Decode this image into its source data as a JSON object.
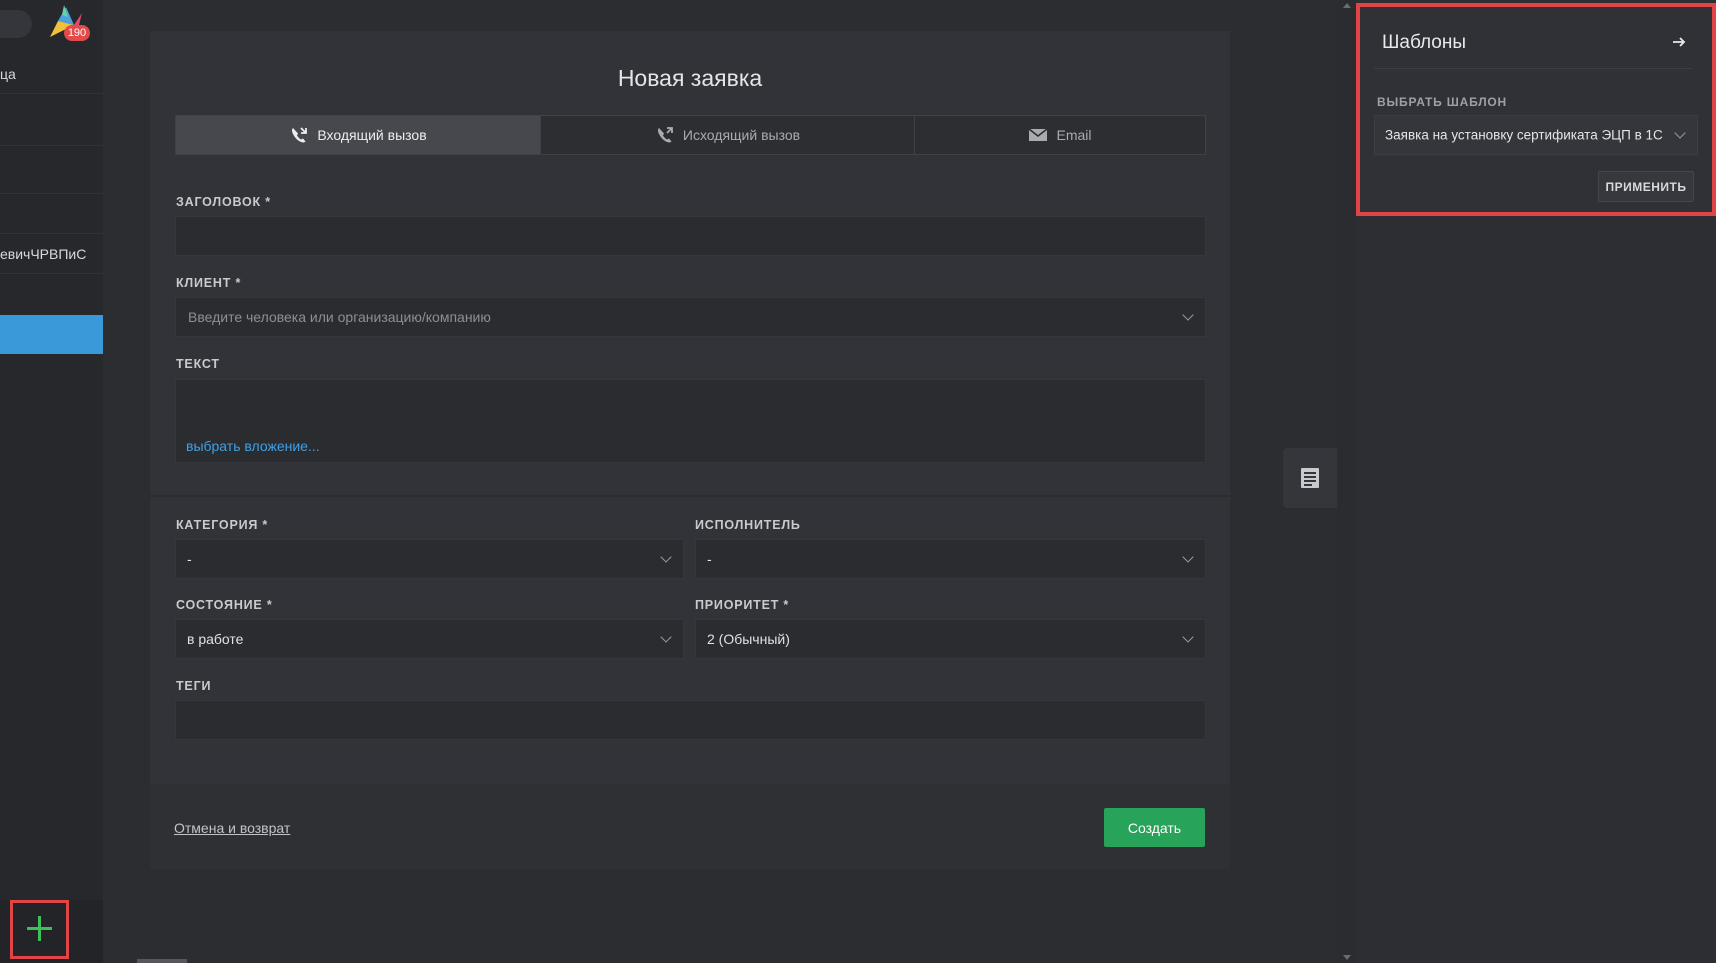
{
  "sidebar": {
    "badge_count": "190",
    "items": [
      {
        "label": "ца"
      },
      {
        "label": ""
      },
      {
        "label": ""
      },
      {
        "label": ""
      },
      {
        "label": "евичЧРВПиС"
      }
    ]
  },
  "form": {
    "title": "Новая заявка",
    "tabs": [
      {
        "label": "Входящий вызов",
        "icon": "incoming-call-icon",
        "active": true
      },
      {
        "label": "Исходящий вызов",
        "icon": "outgoing-call-icon",
        "active": false
      },
      {
        "label": "Email",
        "icon": "mail-icon",
        "active": false
      }
    ],
    "fields": {
      "title_label": "ЗАГОЛОВОК *",
      "title_value": "",
      "client_label": "КЛИЕНТ *",
      "client_placeholder": "Введите человека или организацию/компанию",
      "text_label": "ТЕКСТ",
      "attachment_link": "выбрать вложение...",
      "category_label": "КАТЕГОРИЯ *",
      "category_value": "-",
      "assignee_label": "ИСПОЛНИТЕЛЬ",
      "assignee_value": "-",
      "state_label": "СОСТОЯНИЕ *",
      "state_value": "в работе",
      "priority_label": "ПРИОРИТЕТ *",
      "priority_value": "2 (Обычный)",
      "tags_label": "ТЕГИ"
    },
    "footer": {
      "cancel_label": "Отмена и возврат",
      "create_label": "Создать"
    }
  },
  "templates": {
    "title": "Шаблоны",
    "select_label": "ВЫБРАТЬ ШАБЛОН",
    "selected": "Заявка на установку сертификата ЭЦП в 1С",
    "apply_label": "ПРИМЕНИТЬ"
  },
  "colors": {
    "accent_green": "#27a35a",
    "accent_blue": "#3a9ad9",
    "highlight_red": "#e04444"
  }
}
